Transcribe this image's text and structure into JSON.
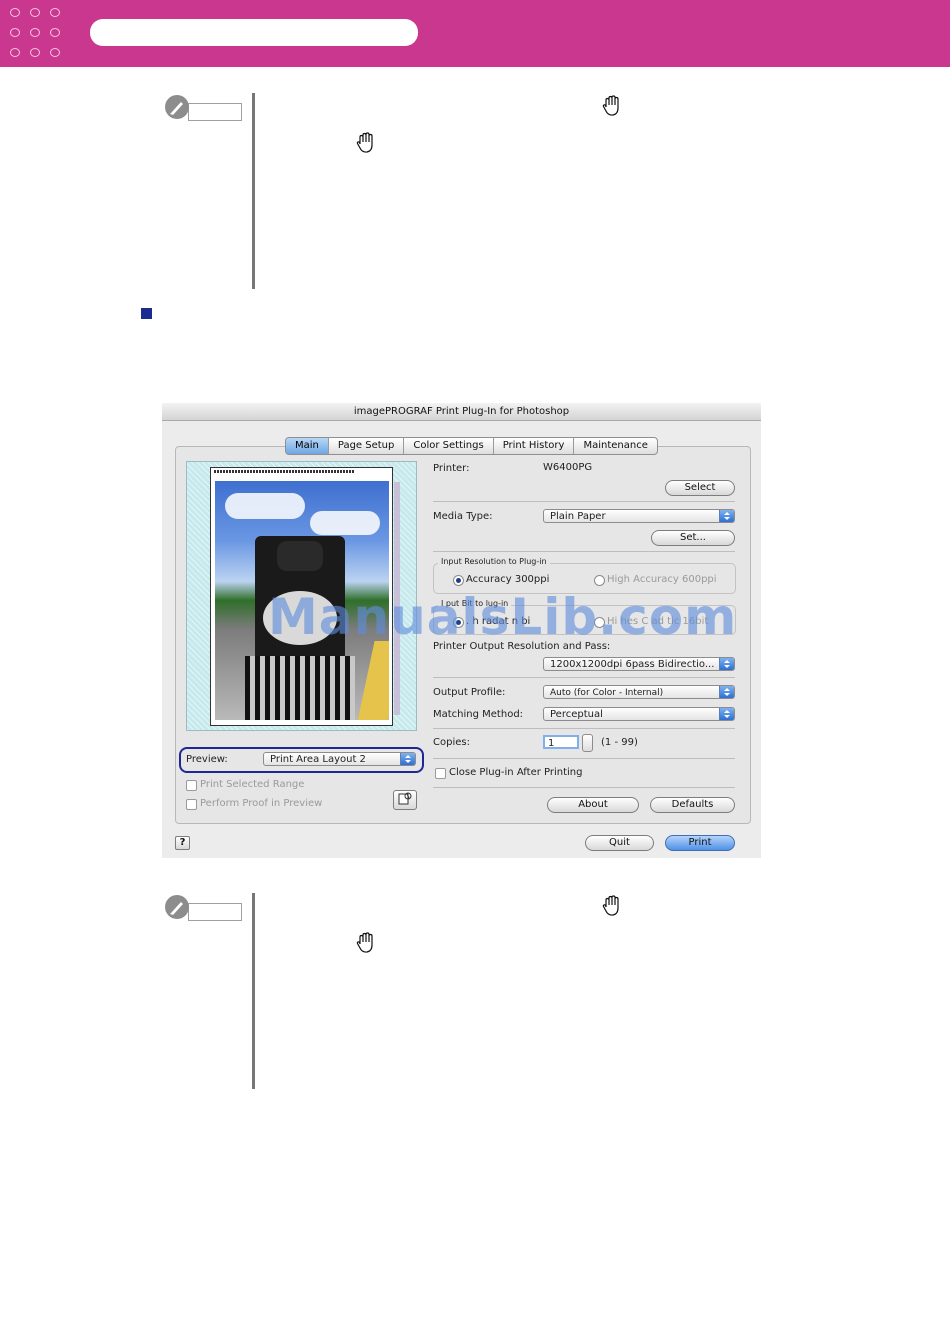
{
  "colors": {
    "banner": "#c9378f",
    "section_marker": "#1a2c8f",
    "preview_highlight": "#1d2896"
  },
  "header": {
    "logo_icon": "dot-grid-icon",
    "title_pill": ""
  },
  "note_top": {
    "icon": "pencil-icon",
    "hand_icons": [
      "hand-icon",
      "hand-icon"
    ]
  },
  "note_bottom": {
    "icon": "pencil-icon",
    "hand_icons": [
      "hand-icon",
      "hand-icon"
    ]
  },
  "dialog": {
    "title": "imagePROGRAF Print Plug-In for Photoshop",
    "tabs": [
      {
        "label": "Main",
        "active": true
      },
      {
        "label": "Page Setup",
        "active": false
      },
      {
        "label": "Color Settings",
        "active": false
      },
      {
        "label": "Print History",
        "active": false
      },
      {
        "label": "Maintenance",
        "active": false
      }
    ],
    "preview": {
      "label": "Preview:",
      "value": "Print Area Layout 2",
      "print_selected_range": "Print Selected Range",
      "perform_proof": "Perform Proof in Preview"
    },
    "printer": {
      "label": "Printer:",
      "value": "W6400PG",
      "select_button": "Select"
    },
    "media_type": {
      "label": "Media Type:",
      "value": "Plain Paper",
      "set_button": "Set..."
    },
    "input_resolution": {
      "title": "Input Resolution to Plug-in",
      "option_1": "Accuracy 300ppi",
      "option_2": "High Accuracy 600ppi",
      "selected": "Accuracy 300ppi"
    },
    "input_bit": {
      "title": "I  put Bit to  lug-in",
      "option_1": ".  h  radat  n  bi",
      "option_2": "Hi  hes   C  ad  tic   16bit"
    },
    "output_resolution": {
      "label": "Printer Output Resolution and Pass:",
      "value": "1200x1200dpi 6pass Bidirectio..."
    },
    "output_profile": {
      "label": "Output Profile:",
      "value": "Auto (for Color - Internal)"
    },
    "matching_method": {
      "label": "Matching Method:",
      "value": "Perceptual"
    },
    "copies": {
      "label": "Copies:",
      "value": "1",
      "range": "(1 - 99)"
    },
    "close_after_printing": "Close Plug-in After Printing",
    "about_button": "About",
    "defaults_button": "Defaults",
    "quit_button": "Quit",
    "print_button": "Print",
    "help_button": "?"
  },
  "watermark": "ManualsLib.com"
}
